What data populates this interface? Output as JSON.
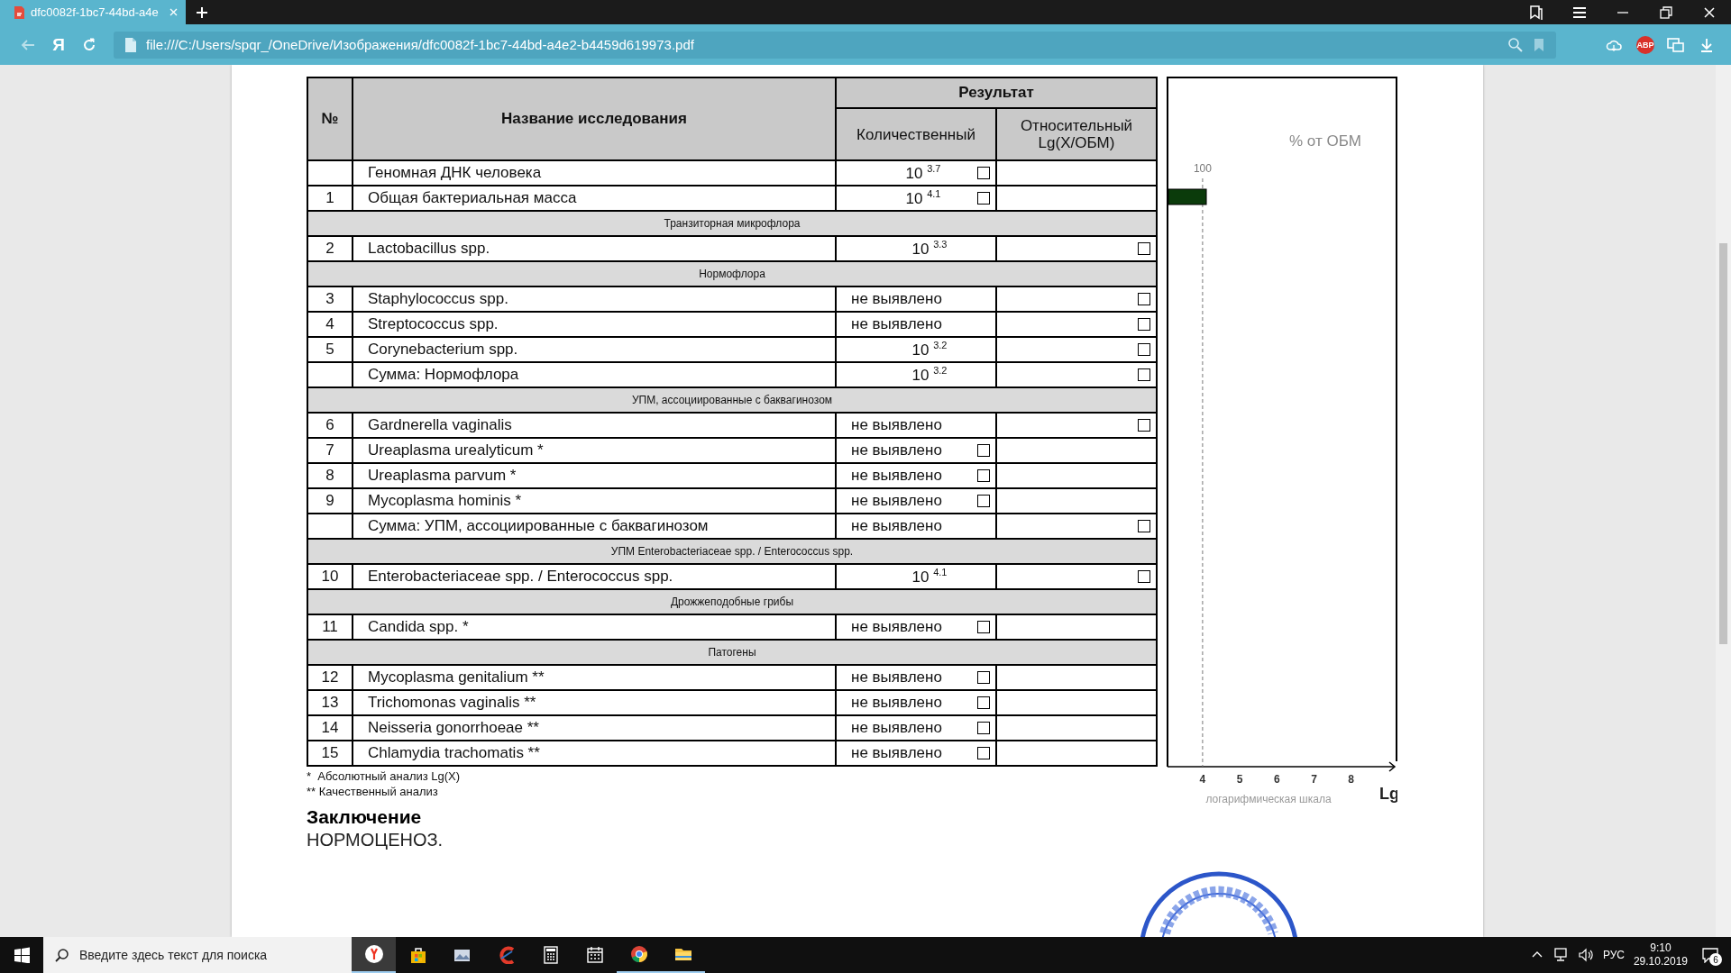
{
  "browser": {
    "tab": {
      "title": "dfc0082f-1bc7-44bd-a4e"
    },
    "brand_letter": "Я",
    "address": "file:///C:/Users/spqr_/OneDrive/Изображения/dfc0082f-1bc7-44bd-a4e2-b4459d619973.pdf",
    "adblock_badge": "ABP"
  },
  "table": {
    "columns": {
      "number": "№",
      "name": "Название исследования",
      "result": "Результат",
      "quantitative": "Количественный",
      "relative": "Относительный Lg(X/ОБМ)"
    },
    "rows": [
      {
        "kind": "test",
        "name": "Геномная ДНК человека",
        "result": {
          "kind": "power",
          "text": "10 $^{3.7}$"
        },
        "checkbox": {
          "kind": "quantitative"
        }
      },
      {
        "kind": "test",
        "number": "1",
        "name": "Общая бактериальная масса",
        "result": {
          "kind": "power",
          "text": "10 $^{4.1}$"
        },
        "checkbox": {
          "kind": "quantitative"
        }
      },
      {
        "kind": "section",
        "name": "Транзиторная микрофлора"
      },
      {
        "kind": "test",
        "number": "2",
        "name": "Lactobacillus spp.",
        "result": {
          "kind": "power",
          "text": "10 $^{3.3}$"
        },
        "checkbox": {
          "kind": "relative"
        }
      },
      {
        "kind": "section",
        "name": "Нормофлора"
      },
      {
        "kind": "test",
        "number": "3",
        "name": "Staphylococcus spp.",
        "result": {
          "kind": "plain",
          "text": "не выявлено"
        },
        "checkbox": {
          "kind": "relative"
        }
      },
      {
        "kind": "test",
        "number": "4",
        "name": "Streptococcus spp.",
        "result": {
          "kind": "plain",
          "text": "не выявлено"
        },
        "checkbox": {
          "kind": "relative"
        }
      },
      {
        "kind": "test",
        "number": "5",
        "name": "Corynebacterium spp.",
        "result": {
          "kind": "power",
          "text": "10 $^{3.2}$"
        },
        "checkbox": {
          "kind": "relative"
        }
      },
      {
        "kind": "test",
        "name": "Сумма: Нормофлора",
        "result": {
          "kind": "power",
          "text": "10 $^{3.2}$"
        },
        "checkbox": {
          "kind": "relative"
        }
      },
      {
        "kind": "section",
        "name": "УПМ, ассоциированные с баквагинозом"
      },
      {
        "kind": "test",
        "number": "6",
        "name": "Gardnerella vaginalis",
        "result": {
          "kind": "plain",
          "text": "не выявлено"
        },
        "checkbox": {
          "kind": "relative"
        }
      },
      {
        "kind": "test",
        "number": "7",
        "name": "Ureaplasma urealyticum *",
        "result": {
          "kind": "plain",
          "text": "не выявлено"
        },
        "checkbox": {
          "kind": "quantitative"
        }
      },
      {
        "kind": "test",
        "number": "8",
        "name": "Ureaplasma parvum *",
        "result": {
          "kind": "plain",
          "text": "не выявлено"
        },
        "checkbox": {
          "kind": "quantitative"
        }
      },
      {
        "kind": "test",
        "number": "9",
        "name": "Mycoplasma hominis *",
        "result": {
          "kind": "plain",
          "text": "не выявлено"
        },
        "checkbox": {
          "kind": "quantitative"
        }
      },
      {
        "kind": "test",
        "name": "Сумма: УПМ, ассоциированные с баквагинозом",
        "result": {
          "kind": "plain",
          "text": "не выявлено"
        },
        "checkbox": {
          "kind": "relative"
        }
      },
      {
        "kind": "section",
        "name": "УПМ Enterobacteriaceae spp. / Enterococcus spp."
      },
      {
        "kind": "test",
        "number": "10",
        "name": "Enterobacteriaceae spp. / Enterococcus spp.",
        "result": {
          "kind": "power",
          "text": "10 $^{4.1}$"
        },
        "checkbox": {
          "kind": "relative"
        }
      },
      {
        "kind": "section",
        "name": "Дрожжеподобные грибы"
      },
      {
        "kind": "test",
        "number": "11",
        "name": "Candida spp. *",
        "result": {
          "kind": "plain",
          "text": "не выявлено"
        },
        "checkbox": {
          "kind": "quantitative"
        }
      },
      {
        "kind": "section",
        "name": "Патогены"
      },
      {
        "kind": "test",
        "number": "12",
        "name": "Mycoplasma genitalium **",
        "result": {
          "kind": "plain",
          "text": "не выявлено"
        },
        "checkbox": {
          "kind": "quantitative"
        }
      },
      {
        "kind": "test",
        "number": "13",
        "name": "Trichomonas vaginalis **",
        "result": {
          "kind": "plain",
          "text": "не выявлено"
        },
        "checkbox": {
          "kind": "quantitative"
        }
      },
      {
        "kind": "test",
        "number": "14",
        "name": "Neisseria gonorrhoeae **",
        "result": {
          "kind": "plain",
          "text": "не выявлено"
        },
        "checkbox": {
          "kind": "quantitative"
        }
      },
      {
        "kind": "test",
        "number": "15",
        "name": "Chlamydia trachomatis **",
        "result": {
          "kind": "plain",
          "text": "не выявлено"
        },
        "checkbox": {
          "kind": "quantitative"
        }
      }
    ]
  },
  "chart": {
    "unit_label": "Lg",
    "chart_data": {
      "type": "bar",
      "orientation": "horizontal",
      "title": "% от ОБМ",
      "xlabel": "логарифмическая шкала",
      "xlim": [
        3.08,
        9.1
      ],
      "xticks": [
        {
          "value": 4,
          "label": "4"
        },
        {
          "value": 5,
          "label": "5"
        },
        {
          "value": 6,
          "label": "6"
        },
        {
          "value": 7,
          "label": "7"
        },
        {
          "value": 8,
          "label": "8"
        }
      ],
      "values": [
        4.1
      ],
      "color": "#0b3b0b",
      "annotations": [
        "100"
      ]
    }
  },
  "footnotes": [
    "*  Абсолютный анализ Lg(X)",
    "** Качественный анализ"
  ],
  "conclusion": {
    "heading": "Заключение",
    "text": "НОРМОЦЕНОЗ."
  },
  "taskbar": {
    "search_placeholder": "Введите здесь текст для поиска",
    "language": "РУС",
    "time": "9:10",
    "date": "29.10.2019",
    "notifications": "6"
  }
}
